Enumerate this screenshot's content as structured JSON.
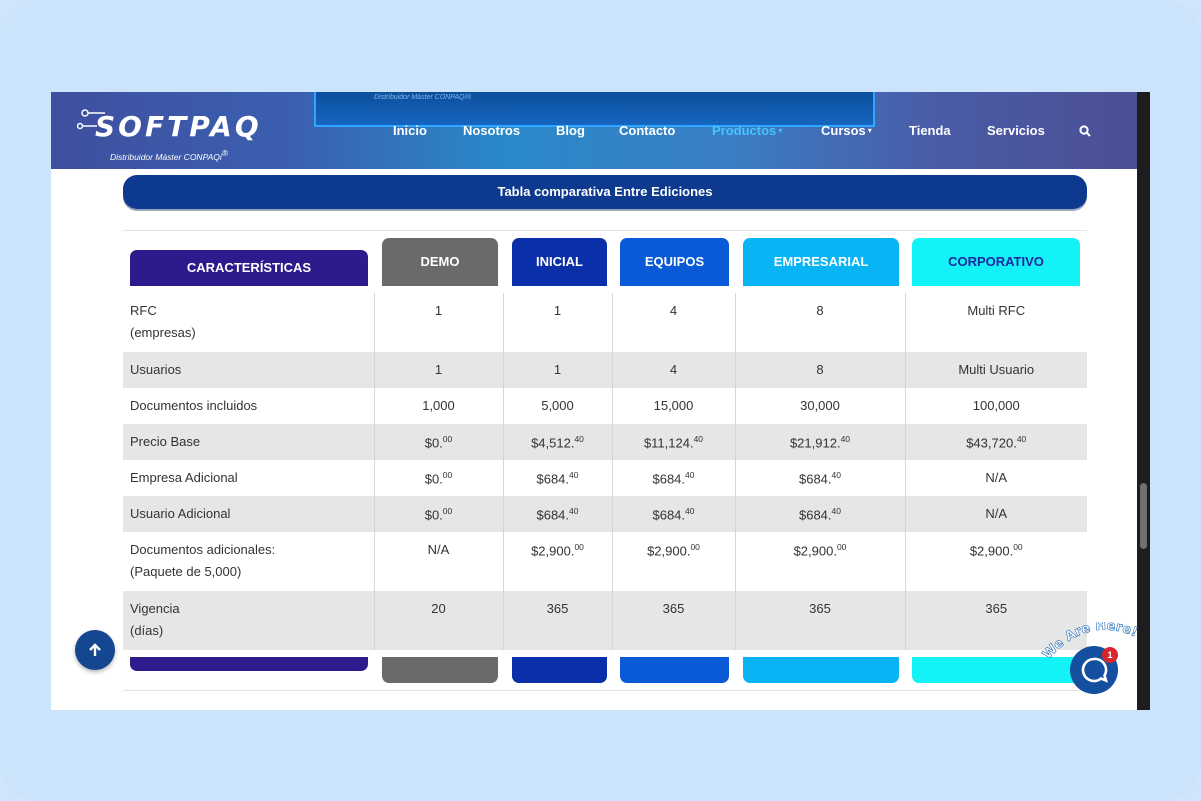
{
  "header": {
    "logo_text": "SOFTPAQ",
    "logo_subtitle": "Distribuidor Máster CONPAQi",
    "logo_sup": "®",
    "banner_text": "Distribuidor Máster CONPAQi®",
    "nav": [
      {
        "label": "Inicio"
      },
      {
        "label": "Nosotros"
      },
      {
        "label": "Blog"
      },
      {
        "label": "Contacto"
      },
      {
        "label": "Productos",
        "caret": "▾"
      },
      {
        "label": "Cursos",
        "caret": "▾"
      },
      {
        "label": "Tienda"
      },
      {
        "label": "Servicios"
      }
    ]
  },
  "section": {
    "title": "Tabla comparativa Entre Ediciones"
  },
  "columns": [
    {
      "label": "CARACTERÍSTICAS",
      "color": "#2b1b8c"
    },
    {
      "label": "DEMO",
      "color": "#6a6a6a"
    },
    {
      "label": "INICIAL",
      "color": "#0b2fa8"
    },
    {
      "label": "EQUIPOS",
      "color": "#0a5ad8"
    },
    {
      "label": "EMPRESARIAL",
      "color": "#09b4f5"
    },
    {
      "label": "CORPORATIVO",
      "color": "#13f2f6",
      "text_color": "#1a2a9e"
    }
  ],
  "rows": [
    {
      "feature": "RFC",
      "feature_sub": "(empresas)",
      "values": [
        [
          "1",
          ""
        ],
        [
          "1",
          ""
        ],
        [
          "4",
          ""
        ],
        [
          "8",
          ""
        ],
        [
          "Multi RFC",
          ""
        ]
      ]
    },
    {
      "feature": "Usuarios",
      "values": [
        [
          "1",
          ""
        ],
        [
          "1",
          ""
        ],
        [
          "4",
          ""
        ],
        [
          "8",
          ""
        ],
        [
          "Multi Usuario",
          ""
        ]
      ]
    },
    {
      "feature": "Documentos incluidos",
      "values": [
        [
          "1,000",
          ""
        ],
        [
          "5,000",
          ""
        ],
        [
          "15,000",
          ""
        ],
        [
          "30,000",
          ""
        ],
        [
          "100,000",
          ""
        ]
      ]
    },
    {
      "feature": "Precio Base",
      "values": [
        [
          "$0.",
          "00"
        ],
        [
          "$4,512.",
          "40"
        ],
        [
          "$11,124.",
          "40"
        ],
        [
          "$21,912.",
          "40"
        ],
        [
          "$43,720.",
          "40"
        ]
      ]
    },
    {
      "feature": "Empresa Adicional",
      "values": [
        [
          "$0.",
          "00"
        ],
        [
          "$684.",
          "40"
        ],
        [
          "$684.",
          "40"
        ],
        [
          "$684.",
          "40"
        ],
        [
          "N/A",
          ""
        ]
      ]
    },
    {
      "feature": "Usuario Adicional",
      "values": [
        [
          "$0.",
          "00"
        ],
        [
          "$684.",
          "40"
        ],
        [
          "$684.",
          "40"
        ],
        [
          "$684.",
          "40"
        ],
        [
          "N/A",
          ""
        ]
      ]
    },
    {
      "feature": "Documentos adicionales:",
      "feature_sub": "(Paquete de 5,000)",
      "values": [
        [
          "N/A",
          ""
        ],
        [
          "$2,900.",
          "00"
        ],
        [
          "$2,900.",
          "00"
        ],
        [
          "$2,900.",
          "00"
        ],
        [
          "$2,900.",
          "00"
        ]
      ]
    },
    {
      "feature": "Vigencia",
      "feature_sub": "(días)",
      "values": [
        [
          "20",
          ""
        ],
        [
          "365",
          ""
        ],
        [
          "365",
          ""
        ],
        [
          "365",
          ""
        ],
        [
          "365",
          ""
        ]
      ]
    }
  ],
  "chat": {
    "label": "We Are Here!",
    "badge": "1"
  }
}
